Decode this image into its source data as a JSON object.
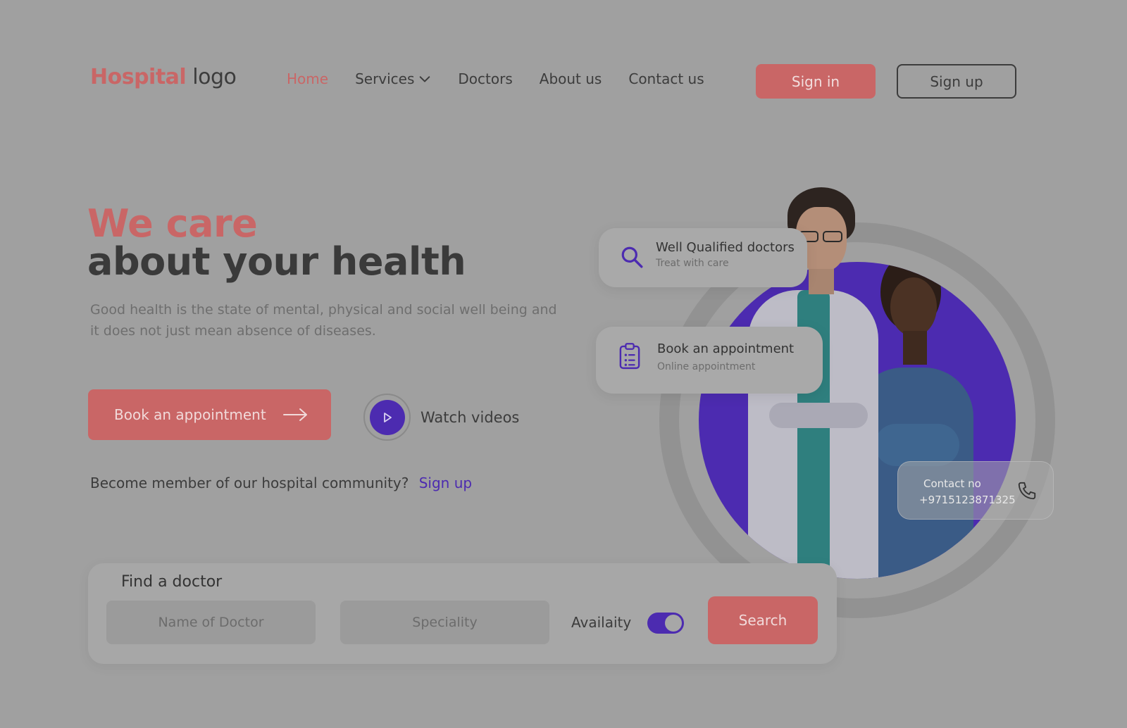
{
  "header": {
    "logo_brand": "Hospital",
    "logo_rest": "logo",
    "nav": [
      {
        "label": "Home",
        "active": true
      },
      {
        "label": "Services",
        "has_dropdown": true
      },
      {
        "label": "Doctors"
      },
      {
        "label": "About us"
      },
      {
        "label": "Contact us"
      }
    ],
    "signin_label": "Sign in",
    "signup_label": "Sign up"
  },
  "hero": {
    "headline_1": "We care",
    "headline_2": "about your health",
    "description": "Good health is the state of mental, physical and social well being and it does not just mean absence of diseases.",
    "book_label": "Book an appointment",
    "watch_label": "Watch videos",
    "member_text": "Become member of our hospital community?",
    "member_link": "Sign up"
  },
  "cards": {
    "qualified": {
      "title": "Well Qualified doctors",
      "subtitle": "Treat with care",
      "icon": "search-icon"
    },
    "appointment": {
      "title": "Book an appointment",
      "subtitle": "Online appointment",
      "icon": "clipboard-icon"
    },
    "contact": {
      "label": "Contact no",
      "number": "+9715123871325",
      "icon": "phone-icon"
    }
  },
  "finder": {
    "title": "Find a doctor",
    "name_placeholder": "Name of Doctor",
    "specialty_placeholder": "Speciality",
    "availability_label": "Availaity",
    "availability_on": true,
    "search_label": "Search"
  },
  "colors": {
    "accent": "#c96666",
    "primary": "#4c2bb0",
    "background": "#a0a0a0"
  }
}
